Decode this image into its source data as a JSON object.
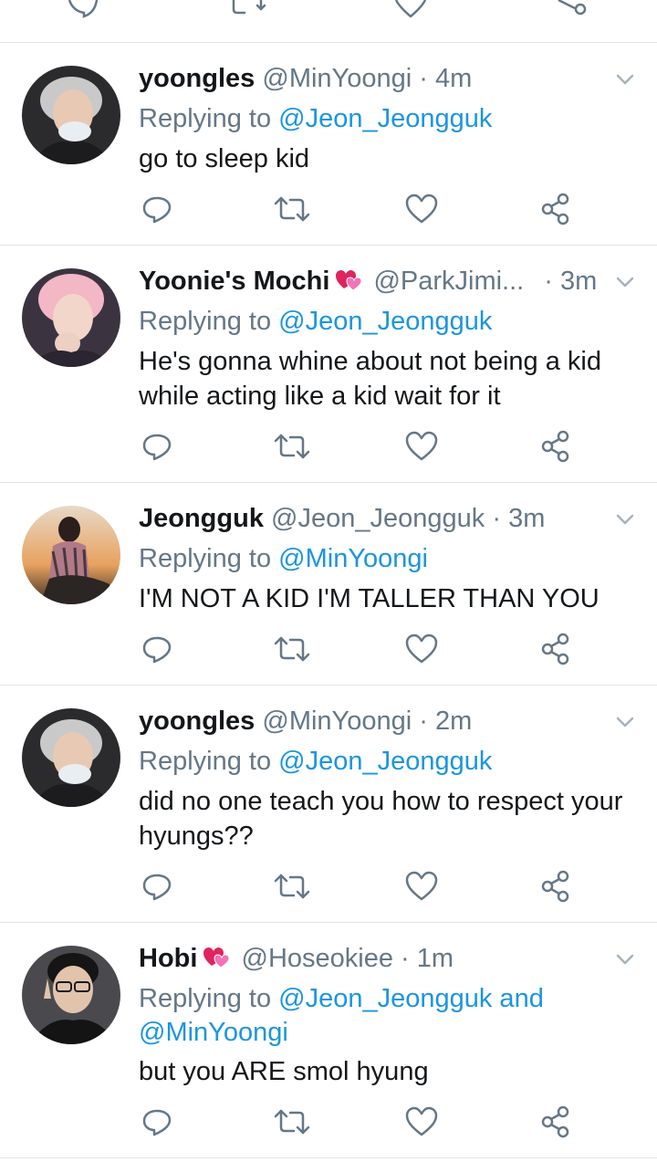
{
  "actions_labels": {
    "reply": "reply",
    "retweet": "retweet",
    "like": "like",
    "share": "share"
  },
  "tweets": [
    {
      "name": "yoongles",
      "handle": "@MinYoongi",
      "sep": "·",
      "time": "4m",
      "replying_prefix": "Replying to",
      "mentions_line1": "@Jeon_Jeongguk",
      "mentions_line2": "",
      "text": "go to sleep kid",
      "avatar": "yoongi-avatar",
      "emoji": ""
    },
    {
      "name": "Yoonie's Mochi",
      "handle": "@ParkJimi...",
      "sep": "·",
      "time": "3m",
      "replying_prefix": "Replying to",
      "mentions_line1": "@Jeon_Jeongguk",
      "mentions_line2": "",
      "text": "He's gonna whine about not being a kid while acting like a kid wait for it",
      "avatar": "jimin-avatar",
      "emoji": "💞"
    },
    {
      "name": "Jeongguk",
      "handle": "@Jeon_Jeongguk",
      "sep": "·",
      "time": "3m",
      "replying_prefix": "Replying to",
      "mentions_line1": "@MinYoongi",
      "mentions_line2": "",
      "text": "I'M NOT A KID I'M TALLER THAN YOU",
      "avatar": "jeongguk-avatar",
      "emoji": ""
    },
    {
      "name": "yoongles",
      "handle": "@MinYoongi",
      "sep": "·",
      "time": "2m",
      "replying_prefix": "Replying to",
      "mentions_line1": "@Jeon_Jeongguk",
      "mentions_line2": "",
      "text": "did no one teach you how to respect your hyungs??",
      "avatar": "yoongi-avatar",
      "emoji": ""
    },
    {
      "name": "Hobi",
      "handle": "@Hoseokiee",
      "sep": "·",
      "time": "1m",
      "replying_prefix": "Replying to",
      "mentions_line1": "@Jeon_Jeongguk and",
      "mentions_line2": "@MinYoongi",
      "text": "but you ARE smol hyung",
      "avatar": "hobi-avatar",
      "emoji": "💞"
    }
  ],
  "colors": {
    "text": "#14171a",
    "muted": "#657786",
    "link": "#1b95e0",
    "divider": "#dfe4e8",
    "icon": "#657786",
    "heart_emoji": "#e0245e"
  }
}
